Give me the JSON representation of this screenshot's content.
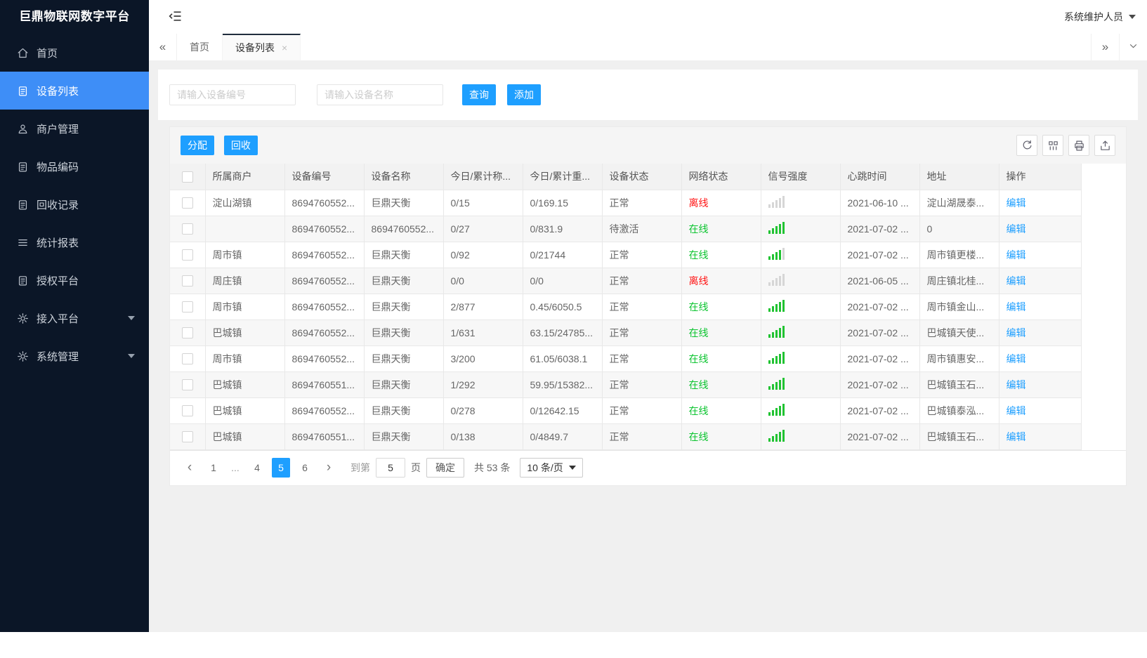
{
  "colors": {
    "accent": "#1e9fff",
    "sidebar_bg": "#0b1627",
    "sidebar_active": "#3e8ef7",
    "online_green": "#0bc42f",
    "offline_red": "#ff1414",
    "signal_green": "#21c332",
    "signal_gray": "#d6d6d6",
    "page_bg": "#f0f0f0"
  },
  "sidebar": {
    "title": "巨鼎物联网数字平台",
    "items": [
      {
        "key": "home",
        "label": "首页",
        "icon": "home-icon",
        "active": false,
        "has_submenu": false
      },
      {
        "key": "device-list",
        "label": "设备列表",
        "icon": "clipboard-icon",
        "active": true,
        "has_submenu": false
      },
      {
        "key": "merchant-management",
        "label": "商户管理",
        "icon": "user-icon",
        "active": false,
        "has_submenu": false
      },
      {
        "key": "item-code",
        "label": "物品编码",
        "icon": "clipboard-icon",
        "active": false,
        "has_submenu": false
      },
      {
        "key": "recycle-records",
        "label": "回收记录",
        "icon": "clipboard-icon",
        "active": false,
        "has_submenu": false
      },
      {
        "key": "statistics-report",
        "label": "统计报表",
        "icon": "list-lines-icon",
        "active": false,
        "has_submenu": false
      },
      {
        "key": "authorization-platform",
        "label": "授权平台",
        "icon": "clipboard-icon",
        "active": false,
        "has_submenu": false
      },
      {
        "key": "access-platform",
        "label": "接入平台",
        "icon": "gear-icon",
        "active": false,
        "has_submenu": true
      },
      {
        "key": "system-management",
        "label": "系统管理",
        "icon": "gear-icon",
        "active": false,
        "has_submenu": true
      }
    ]
  },
  "topbar": {
    "user_name": "系统维护人员"
  },
  "tabbar": {
    "tabs": [
      {
        "key": "home",
        "label": "首页",
        "active": false,
        "closable": false
      },
      {
        "key": "device-list",
        "label": "设备列表",
        "active": true,
        "closable": true
      }
    ],
    "close_glyph": "×"
  },
  "search": {
    "device_no_placeholder": "请输入设备编号",
    "device_name_placeholder": "请输入设备名称",
    "query_label": "查询",
    "add_label": "添加"
  },
  "toolbar": {
    "assign_label": "分配",
    "recycle_label": "回收",
    "icon_buttons": [
      "refresh-icon",
      "columns-filter-icon",
      "print-icon",
      "export-icon"
    ]
  },
  "table": {
    "columns": [
      "所属商户",
      "设备编号",
      "设备名称",
      "今日/累计称...",
      "今日/累计重...",
      "设备状态",
      "网络状态",
      "信号强度",
      "心跳时间",
      "地址",
      "操作"
    ],
    "edit_label": "编辑",
    "rows": [
      {
        "merchant": "淀山湖镇",
        "device_no": "8694760552...",
        "device_name": "巨鼎天衡",
        "today_count": "0/15",
        "today_weight": "0/169.15",
        "status": "正常",
        "network": "离线",
        "online": false,
        "signal_level": 0,
        "heartbeat": "2021-06-10 ...",
        "address": "淀山湖晟泰..."
      },
      {
        "merchant": "",
        "device_no": "8694760552...",
        "device_name": "8694760552...",
        "today_count": "0/27",
        "today_weight": "0/831.9",
        "status": "待激活",
        "network": "在线",
        "online": true,
        "signal_level": 5,
        "heartbeat": "2021-07-02 ...",
        "address": "0"
      },
      {
        "merchant": "周市镇",
        "device_no": "8694760552...",
        "device_name": "巨鼎天衡",
        "today_count": "0/92",
        "today_weight": "0/21744",
        "status": "正常",
        "network": "在线",
        "online": true,
        "signal_level": 4,
        "heartbeat": "2021-07-02 ...",
        "address": "周市镇更楼..."
      },
      {
        "merchant": "周庄镇",
        "device_no": "8694760552...",
        "device_name": "巨鼎天衡",
        "today_count": "0/0",
        "today_weight": "0/0",
        "status": "正常",
        "network": "离线",
        "online": false,
        "signal_level": 0,
        "heartbeat": "2021-06-05 ...",
        "address": "周庄镇北桂..."
      },
      {
        "merchant": "周市镇",
        "device_no": "8694760552...",
        "device_name": "巨鼎天衡",
        "today_count": "2/877",
        "today_weight": "0.45/6050.5",
        "status": "正常",
        "network": "在线",
        "online": true,
        "signal_level": 5,
        "heartbeat": "2021-07-02 ...",
        "address": "周市镇金山..."
      },
      {
        "merchant": "巴城镇",
        "device_no": "8694760552...",
        "device_name": "巨鼎天衡",
        "today_count": "1/631",
        "today_weight": "63.15/24785...",
        "status": "正常",
        "network": "在线",
        "online": true,
        "signal_level": 5,
        "heartbeat": "2021-07-02 ...",
        "address": "巴城镇天使..."
      },
      {
        "merchant": "周市镇",
        "device_no": "8694760552...",
        "device_name": "巨鼎天衡",
        "today_count": "3/200",
        "today_weight": "61.05/6038.1",
        "status": "正常",
        "network": "在线",
        "online": true,
        "signal_level": 5,
        "heartbeat": "2021-07-02 ...",
        "address": "周市镇惠安..."
      },
      {
        "merchant": "巴城镇",
        "device_no": "8694760551...",
        "device_name": "巨鼎天衡",
        "today_count": "1/292",
        "today_weight": "59.95/15382...",
        "status": "正常",
        "network": "在线",
        "online": true,
        "signal_level": 5,
        "heartbeat": "2021-07-02 ...",
        "address": "巴城镇玉石..."
      },
      {
        "merchant": "巴城镇",
        "device_no": "8694760552...",
        "device_name": "巨鼎天衡",
        "today_count": "0/278",
        "today_weight": "0/12642.15",
        "status": "正常",
        "network": "在线",
        "online": true,
        "signal_level": 5,
        "heartbeat": "2021-07-02 ...",
        "address": "巴城镇泰泓..."
      },
      {
        "merchant": "巴城镇",
        "device_no": "8694760551...",
        "device_name": "巨鼎天衡",
        "today_count": "0/138",
        "today_weight": "0/4849.7",
        "status": "正常",
        "network": "在线",
        "online": true,
        "signal_level": 5,
        "heartbeat": "2021-07-02 ...",
        "address": "巴城镇玉石..."
      }
    ]
  },
  "pagination": {
    "pages": [
      {
        "label": "1",
        "type": "page",
        "active": false
      },
      {
        "label": "...",
        "type": "ellipsis",
        "active": false
      },
      {
        "label": "4",
        "type": "page",
        "active": false
      },
      {
        "label": "5",
        "type": "page",
        "active": true
      },
      {
        "label": "6",
        "type": "page",
        "active": false
      }
    ],
    "prev_glyph": "‹",
    "next_glyph": "›",
    "goto_label": "到第",
    "goto_value": "5",
    "unit_label": "页",
    "confirm_label": "确定",
    "total_label": "共 53 条",
    "page_size_value": "10 条/页"
  }
}
